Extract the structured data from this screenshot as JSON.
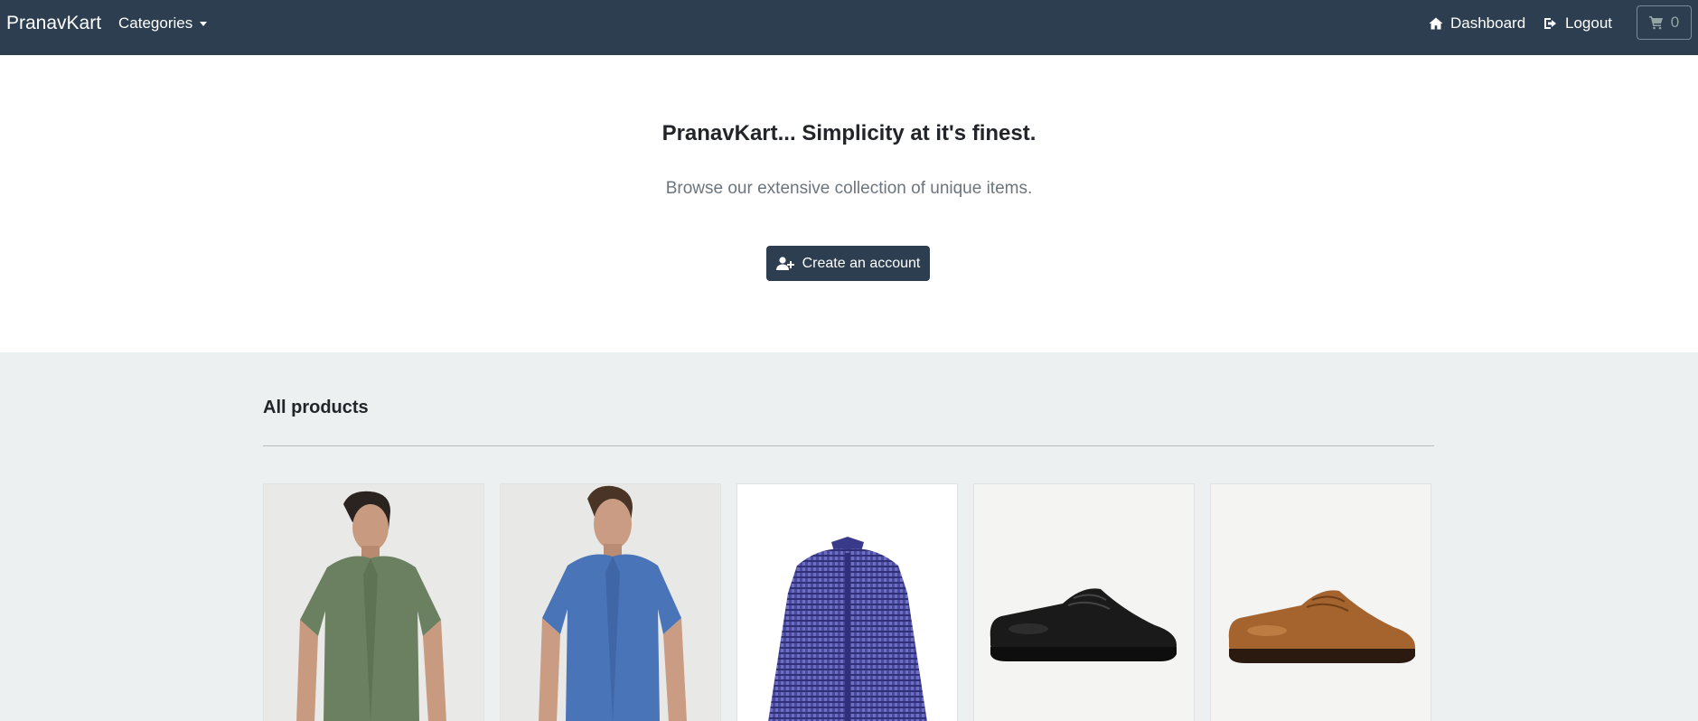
{
  "navbar": {
    "brand": "PranavKart",
    "categories_label": "Categories",
    "dashboard_label": "Dashboard",
    "logout_label": "Logout",
    "cart_count": "0"
  },
  "hero": {
    "title": "PranavKart... Simplicity at it's finest.",
    "subtitle": "Browse our extensive collection of unique items.",
    "create_account_label": "Create an account"
  },
  "products": {
    "section_title": "All products",
    "items": [
      {
        "image": "green-linen-shirt-model",
        "color": "#6b8060"
      },
      {
        "image": "blue-linen-shirt-model",
        "color": "#4a74b8"
      },
      {
        "image": "purple-checked-dress-shirt",
        "color": "#4a4aa0"
      },
      {
        "image": "black-leather-derby-shoe",
        "color": "#1a1a1a"
      },
      {
        "image": "tan-leather-derby-shoe",
        "color": "#a5642e"
      }
    ]
  },
  "colors": {
    "navbar_bg": "#2c3e50",
    "products_bg": "#ecf0f1",
    "accent": "#2c3e50"
  }
}
